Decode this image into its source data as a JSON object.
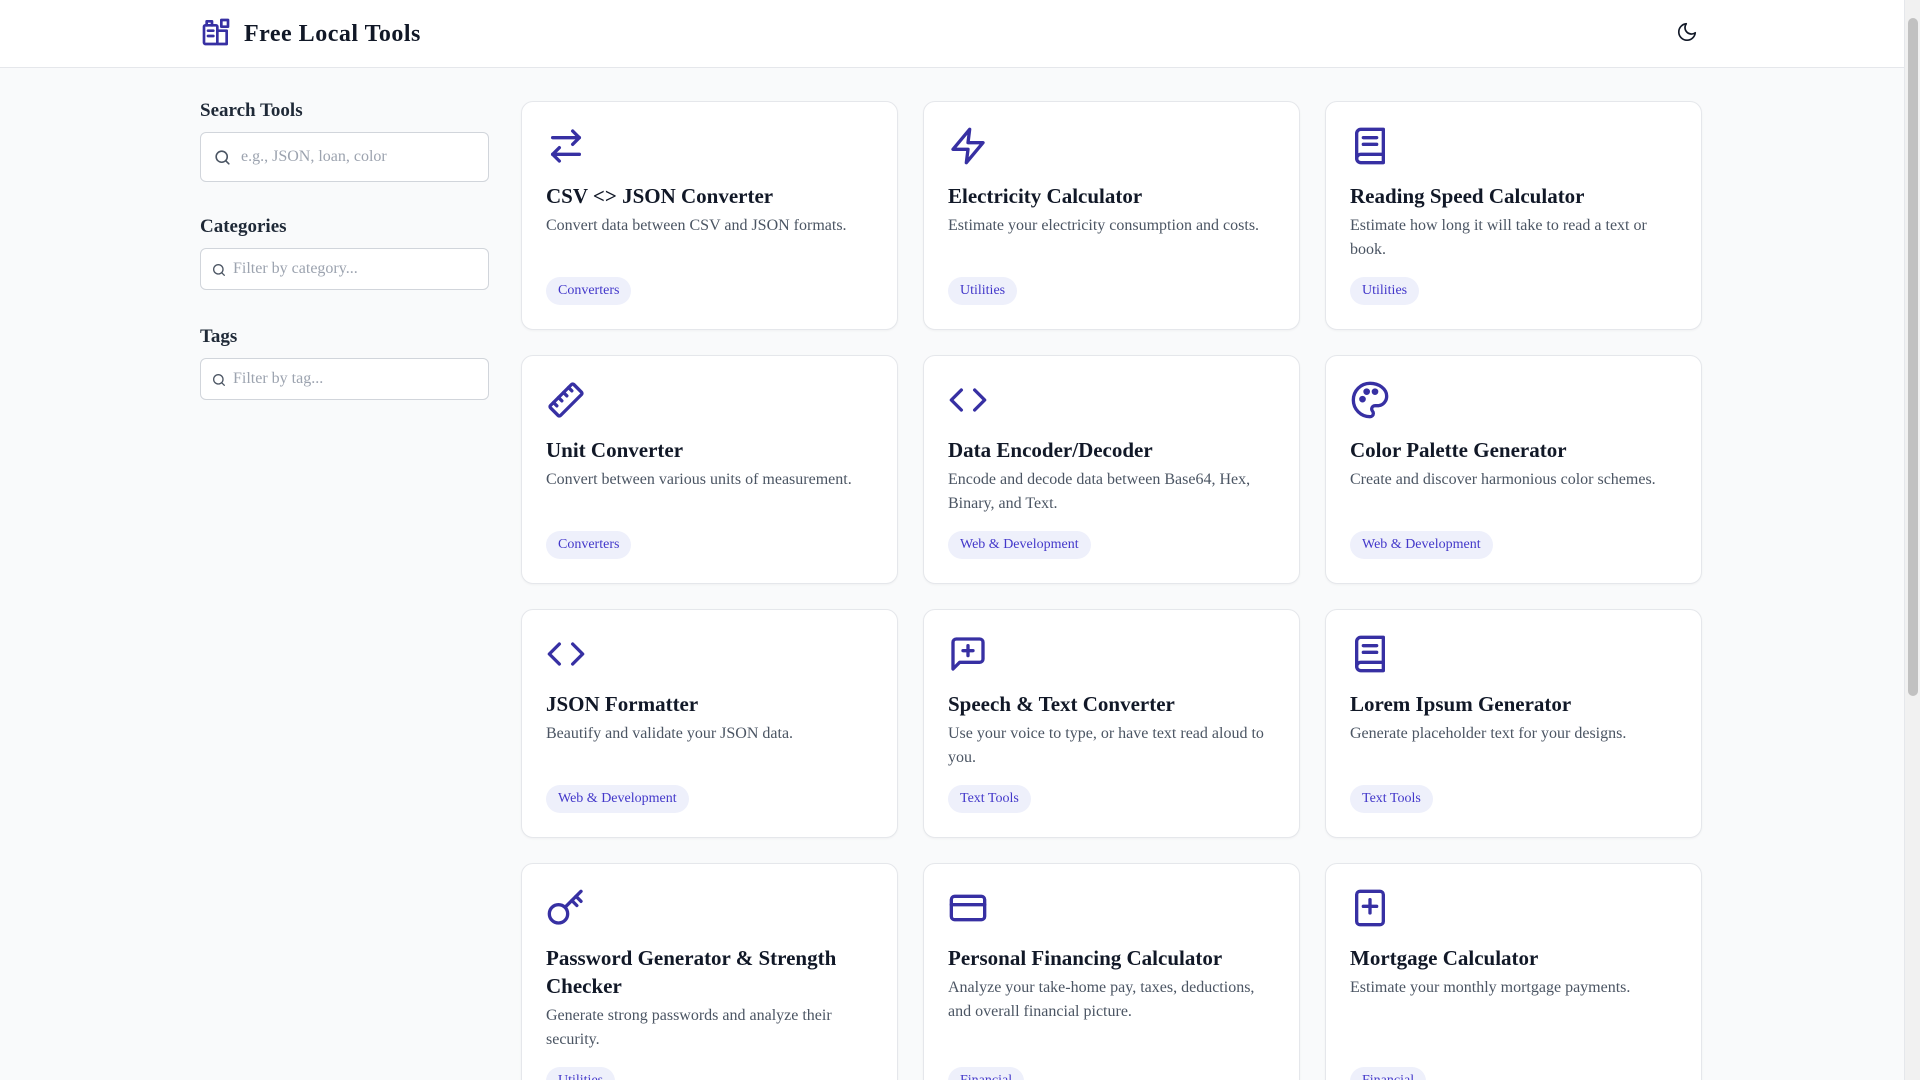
{
  "header": {
    "app_title": "Free Local Tools",
    "logo_icon": "toolbox-icon",
    "theme_toggle_icon": "moon-icon"
  },
  "sidebar": {
    "search": {
      "heading": "Search Tools",
      "placeholder": "e.g., JSON, loan, color",
      "value": ""
    },
    "categories": {
      "heading": "Categories",
      "placeholder": "Filter by category...",
      "value": ""
    },
    "tags": {
      "heading": "Tags",
      "placeholder": "Filter by tag...",
      "value": ""
    }
  },
  "tools": [
    {
      "title": "CSV <> JSON Converter",
      "description": "Convert data between CSV and JSON formats.",
      "category": "Converters",
      "icon": "arrows-left-right-icon"
    },
    {
      "title": "Electricity Calculator",
      "description": "Estimate your electricity consumption and costs.",
      "category": "Utilities",
      "icon": "lightning-icon"
    },
    {
      "title": "Reading Speed Calculator",
      "description": "Estimate how long it will take to read a text or book.",
      "category": "Utilities",
      "icon": "book-icon"
    },
    {
      "title": "Unit Converter",
      "description": "Convert between various units of measurement.",
      "category": "Converters",
      "icon": "ruler-icon"
    },
    {
      "title": "Data Encoder/Decoder",
      "description": "Encode and decode data between Base64, Hex, Binary, and Text.",
      "category": "Web & Development",
      "icon": "code-icon"
    },
    {
      "title": "Color Palette Generator",
      "description": "Create and discover harmonious color schemes.",
      "category": "Web & Development",
      "icon": "palette-icon"
    },
    {
      "title": "JSON Formatter",
      "description": "Beautify and validate your JSON data.",
      "category": "Web & Development",
      "icon": "code-icon"
    },
    {
      "title": "Speech & Text Converter",
      "description": "Use your voice to type, or have text read aloud to you.",
      "category": "Text Tools",
      "icon": "message-plus-icon"
    },
    {
      "title": "Lorem Ipsum Generator",
      "description": "Generate placeholder text for your designs.",
      "category": "Text Tools",
      "icon": "book-icon"
    },
    {
      "title": "Password Generator & Strength Checker",
      "description": "Generate strong passwords and analyze their security.",
      "category": "Utilities",
      "icon": "key-icon"
    },
    {
      "title": "Personal Financing Calculator",
      "description": "Analyze your take-home pay, taxes, deductions, and overall financial picture.",
      "category": "Financial",
      "icon": "credit-card-icon"
    },
    {
      "title": "Mortgage Calculator",
      "description": "Estimate your monthly mortgage payments.",
      "category": "Financial",
      "icon": "square-plus-icon"
    }
  ],
  "colors": {
    "accent": "#3730a3",
    "tag_bg": "#eef0fb",
    "tag_text": "#4338ca",
    "page_bg": "#f9fafb"
  }
}
